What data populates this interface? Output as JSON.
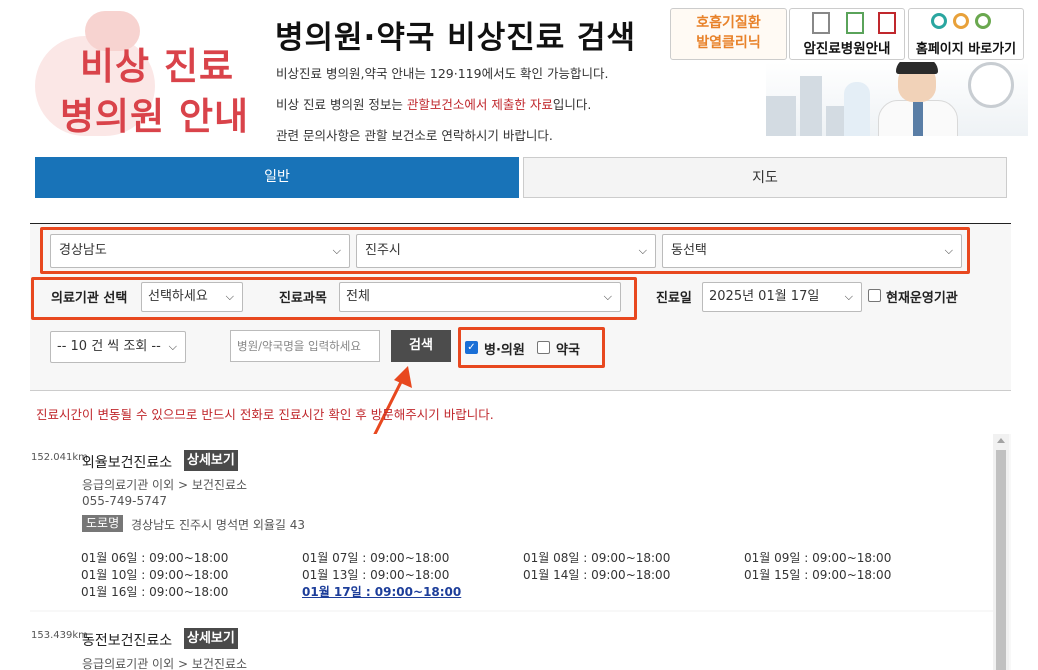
{
  "header": {
    "logo_line1": "비상 진료",
    "logo_line2": "병의원 안내",
    "title": "병의원·약국 비상진료 검색",
    "info1": "비상진료 병의원,약국 안내는 129·119에서도 확인 가능합니다.",
    "info2_pre": "비상 진료 병의원 정보는 ",
    "info2_hl": "관할보건소에서 제출한 자료",
    "info2_post": "입니다.",
    "info3": "관련 문의사항은 관할 보건소로 연락하시기 바랍니다."
  },
  "banners": {
    "fever_clinic_line1": "호흡기질환",
    "fever_clinic_line2": "발열클리닉",
    "cancer_hospital": "암진료병원안내",
    "homepage": "홈페이지 바로가기"
  },
  "tabs": {
    "general": "일반",
    "map": "지도"
  },
  "search": {
    "province": "경상남도",
    "city": "진주시",
    "dong": "동선택",
    "facility_label": "의료기관 선택",
    "facility_value": "선택하세요",
    "department_label": "진료과목",
    "department_value": "전체",
    "date_label": "진료일",
    "date_value": "2025년 01월 17일",
    "open_now_label": "현재운영기관",
    "page_size": "-- 10 건 씩 조회 --",
    "name_placeholder": "병원/약국명을 입력하세요",
    "search_button": "검색",
    "hospital_checkbox": "병·의원",
    "hospital_checked": true,
    "pharmacy_checkbox": "약국",
    "pharmacy_checked": false
  },
  "notice": "진료시간이 변동될 수 있으므로 반드시 전화로 진료시간 확인 후 방문해주시기 바랍니다.",
  "results": [
    {
      "distance": "152.041km",
      "name": "외율보건진료소",
      "detail_button": "상세보기",
      "category": "응급의료기관 이외 > 보건진료소",
      "phone": "055-749-5747",
      "road_label": "도로명",
      "address": "경상남도 진주시 명석면 외율길 43",
      "hours": [
        "01월 06일 : 09:00~18:00",
        "01월 07일 : 09:00~18:00",
        "01월 08일 : 09:00~18:00",
        "01월 09일 : 09:00~18:00",
        "01월 10일 : 09:00~18:00",
        "01월 13일 : 09:00~18:00",
        "01월 14일 : 09:00~18:00",
        "01월 15일 : 09:00~18:00",
        "01월 16일 : 09:00~18:00",
        "01월 17일 : 09:00~18:00"
      ]
    },
    {
      "distance": "153.439km",
      "name": "동전보건진료소",
      "detail_button": "상세보기",
      "category": "응급의료기관 이외 > 보건진료소"
    }
  ]
}
